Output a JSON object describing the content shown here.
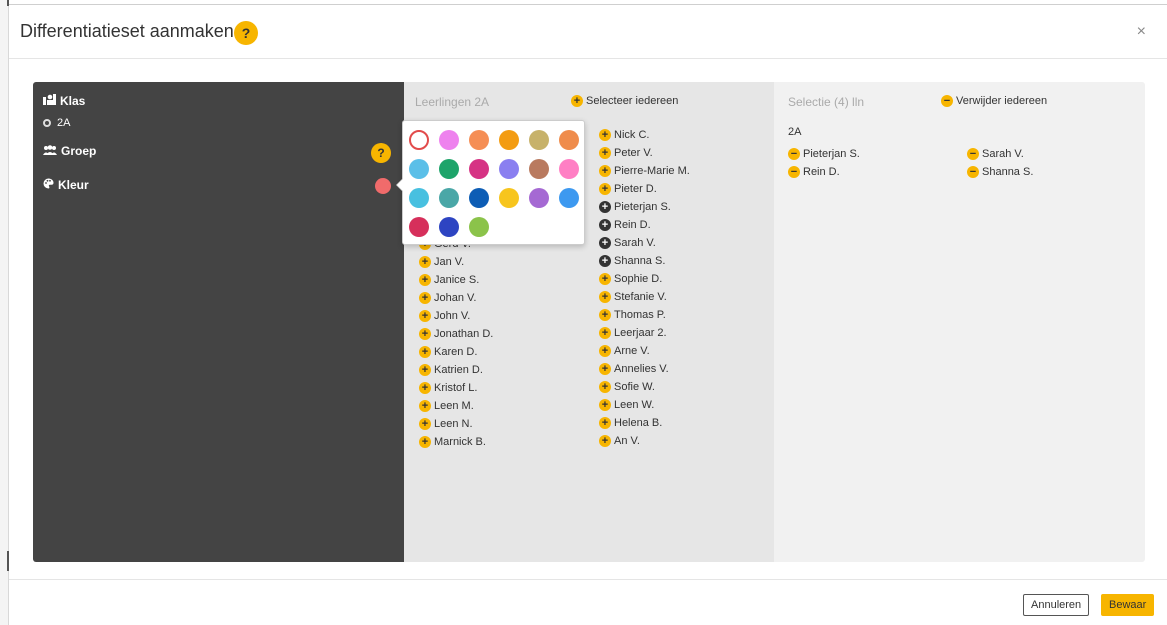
{
  "modal": {
    "title": "Differentiatieset aanmaken",
    "help": "?",
    "close": "×"
  },
  "sidebar": {
    "klas_label": "Klas",
    "klas_value": "2A",
    "groep_label": "Groep",
    "kleur_label": "Kleur",
    "help": "?",
    "current_color": "#f06b6b"
  },
  "students_panel": {
    "title": "Leerlingen 2A",
    "select_all": "Selecteer iedereen",
    "col1": [
      "Gerd V.",
      "Jan V.",
      "Janice S.",
      "Johan V.",
      "John V.",
      "Jonathan D.",
      "Karen D.",
      "Katrien D.",
      "Kristof L.",
      "Leen M.",
      "Leen N.",
      "Marnick B."
    ],
    "col2": [
      {
        "name": "Nick C.",
        "selected": false
      },
      {
        "name": "Peter V.",
        "selected": false
      },
      {
        "name": "Pierre-Marie M.",
        "selected": false
      },
      {
        "name": "Pieter D.",
        "selected": false
      },
      {
        "name": "Pieterjan S.",
        "selected": true
      },
      {
        "name": "Rein D.",
        "selected": true
      },
      {
        "name": "Sarah V.",
        "selected": true
      },
      {
        "name": "Shanna S.",
        "selected": true
      },
      {
        "name": "Sophie D.",
        "selected": false
      },
      {
        "name": "Stefanie V.",
        "selected": false
      },
      {
        "name": "Thomas P.",
        "selected": false
      },
      {
        "name": "Leerjaar 2.",
        "selected": false
      },
      {
        "name": "Arne V.",
        "selected": false
      },
      {
        "name": "Annelies V.",
        "selected": false
      },
      {
        "name": "Sofie W.",
        "selected": false
      },
      {
        "name": "Leen W.",
        "selected": false
      },
      {
        "name": "Helena B.",
        "selected": false
      },
      {
        "name": "An V.",
        "selected": false
      }
    ]
  },
  "selection_panel": {
    "title": "Selectie (4) lln",
    "remove_all": "Verwijder iedereen",
    "group": "2A",
    "col1": [
      "Pieterjan S.",
      "Rein D."
    ],
    "col2": [
      "Sarah V.",
      "Shanna S."
    ]
  },
  "palette": {
    "colors": [
      "none",
      "#ee82ee",
      "#f58e55",
      "#f39c12",
      "#c7b26a",
      "#ef8c4c",
      "#5bbfe8",
      "#1ea46a",
      "#d63384",
      "#8a7ff0",
      "#b97a5f",
      "#ff7fc4",
      "#48c0e0",
      "#4aa7a7",
      "#0d5db5",
      "#f7c51e",
      "#a569d3",
      "#3d99f0",
      "#d62f5b",
      "#2d44c2",
      "#8bc34a"
    ]
  },
  "footer": {
    "cancel": "Annuleren",
    "save": "Bewaar"
  }
}
